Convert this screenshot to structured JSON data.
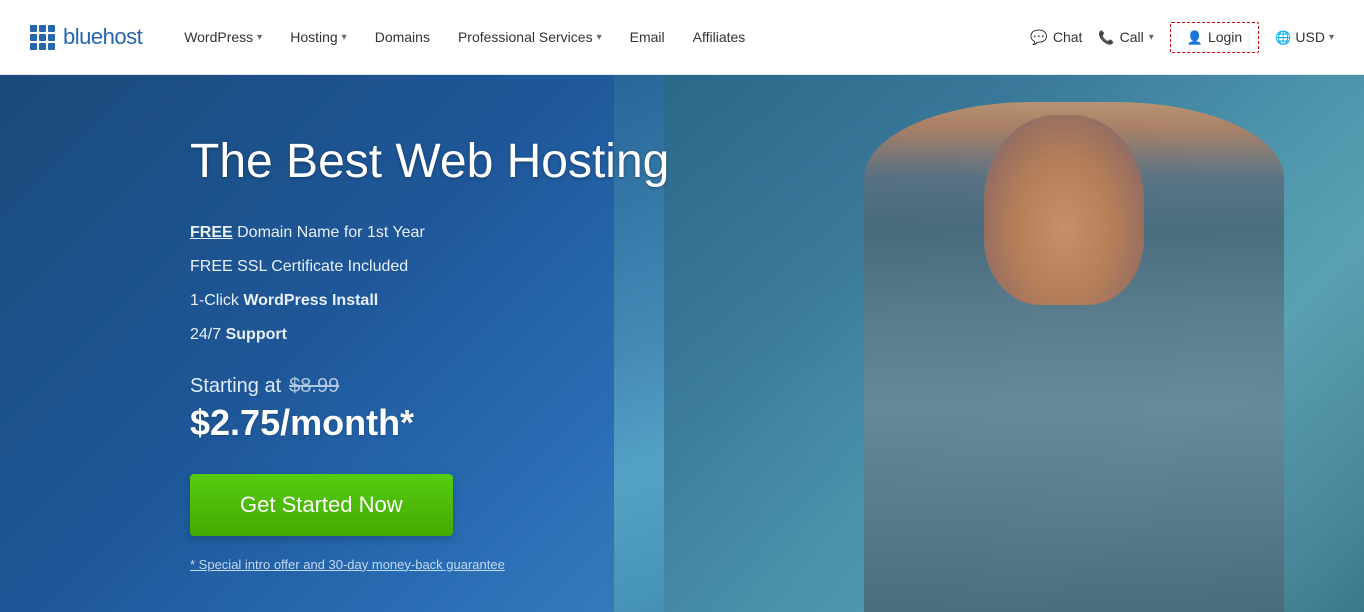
{
  "brand": {
    "name": "bluehost",
    "logo_alt": "Bluehost"
  },
  "header": {
    "nav_items": [
      {
        "id": "wordpress",
        "label": "WordPress",
        "has_dropdown": true
      },
      {
        "id": "hosting",
        "label": "Hosting",
        "has_dropdown": true
      },
      {
        "id": "domains",
        "label": "Domains",
        "has_dropdown": false
      },
      {
        "id": "professional-services",
        "label": "Professional Services",
        "has_dropdown": true
      },
      {
        "id": "email",
        "label": "Email",
        "has_dropdown": false
      },
      {
        "id": "affiliates",
        "label": "Affiliates",
        "has_dropdown": false
      }
    ],
    "actions": {
      "chat_label": "Chat",
      "call_label": "Call",
      "login_label": "Login",
      "currency_label": "USD"
    }
  },
  "hero": {
    "title": "The Best Web Hosting",
    "features": [
      {
        "id": "domain",
        "free_label": "FREE",
        "text": " Domain Name for 1st Year"
      },
      {
        "id": "ssl",
        "text": "FREE SSL Certificate Included"
      },
      {
        "id": "wordpress",
        "prefix": "1-Click ",
        "bold_text": "WordPress Install",
        "suffix": ""
      },
      {
        "id": "support",
        "text": "24/7 ",
        "bold_text": "Support"
      }
    ],
    "pricing": {
      "starting_text": "Starting at",
      "original_price": "$8.99",
      "current_price": "$2.75/month*"
    },
    "cta_label": "Get Started Now",
    "disclaimer": "* Special intro offer and 30-day money-back guarantee"
  }
}
